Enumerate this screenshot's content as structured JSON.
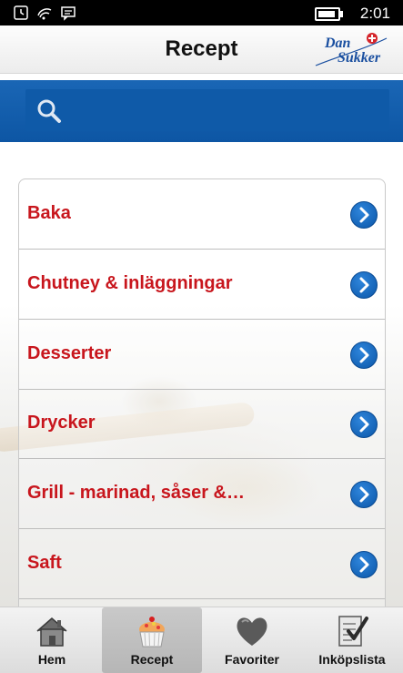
{
  "status_bar": {
    "time": "2:01"
  },
  "header": {
    "title": "Recept",
    "logo_line1": "Dan",
    "logo_line2": "Sukker"
  },
  "search": {
    "placeholder": ""
  },
  "categories": [
    {
      "label": "Baka"
    },
    {
      "label": "Chutney & inläggningar"
    },
    {
      "label": "Desserter"
    },
    {
      "label": "Drycker"
    },
    {
      "label": "Grill - marinad, såser &…"
    },
    {
      "label": "Saft"
    }
  ],
  "tabs": [
    {
      "label": "Hem",
      "icon": "house-icon"
    },
    {
      "label": "Recept",
      "icon": "cupcake-icon",
      "active": true
    },
    {
      "label": "Favoriter",
      "icon": "heart-icon"
    },
    {
      "label": "Inköpslista",
      "icon": "checklist-icon"
    }
  ],
  "colors": {
    "accent_blue": "#0d56a4",
    "label_red": "#c8161d"
  }
}
